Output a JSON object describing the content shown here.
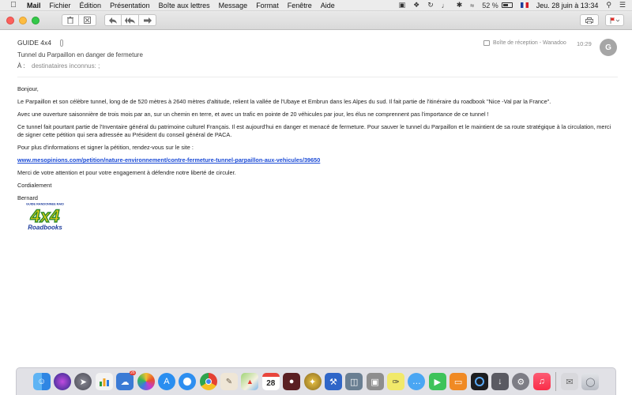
{
  "menubar": {
    "app_name": "Mail",
    "menus": [
      "Fichier",
      "Édition",
      "Présentation",
      "Boîte aux lettres",
      "Message",
      "Format",
      "Fenêtre",
      "Aide"
    ],
    "battery": "52 %",
    "clock": "Jeu. 28 juin à 13:34"
  },
  "message": {
    "subject": "GUIDE 4x4",
    "subtitle": "Tunnel du Parpaillon en danger de fermeture",
    "to_label": "À :",
    "to_value": "destinataires inconnus: ;",
    "mailbox": "Boîte de réception - Wanadoo",
    "time": "10:29",
    "avatar_initial": "G"
  },
  "body": {
    "greeting": "Bonjour,",
    "p1": "Le Parpaillon et son célèbre tunnel, long de de 520 mètres à 2640 mètres d'altitude, relient la vallée de l'Ubaye et Embrun dans les Alpes du sud. Il fait partie de l'itinéraire du roadbook \"Nice -Val par la France\".",
    "p2": "Avec une ouverture saisonnière de trois mois par an, sur un chemin en terre, et avec un trafic en pointe de 20 véhicules par jour, les élus ne comprennent pas l'importance de ce tunnel !",
    "p3": "Ce tunnel fait pourtant partie de l'Inventaire général du patrimoine culturel Français. Il est aujourd'hui en danger et menacé de fermeture. Pour sauver le tunnel du Parpaillon et le maintient de sa route stratégique à la circulation, merci de signer cette pétition qui sera adressée au Président du conseil général de PACA.",
    "p4": "Pour plus d'informations et signer la pétition, rendez-vous sur le site :",
    "link": "www.mesopinions.com/petition/nature-environnement/contre-fermeture-tunnel-parpaillon-aux-vehicules/39650",
    "p5": "Merci de votre attention et pour votre engagement à défendre notre liberté de circuler.",
    "closing": "Cordialement",
    "signature": "Bernard",
    "logo_top": "GUIDE RANDONNEE RAID",
    "logo_main": "4x4",
    "logo_bottom": "Roadbooks"
  },
  "dock": {
    "calendar_day": "28",
    "badge_count": "26",
    "icons": [
      "finder-icon",
      "siri-icon",
      "launchpad-icon",
      "numbers-icon",
      "preview-icon",
      "photos-icon",
      "appstore-icon",
      "safari-icon",
      "chrome-icon",
      "gimp-icon",
      "maps-icon",
      "calendar-icon",
      "photo-booth-icon",
      "compass-icon",
      "xcode-icon",
      "virtualbox-icon",
      "image-capture-icon",
      "script-editor-icon",
      "messages-icon",
      "facetime-icon",
      "books-icon",
      "quicktime-icon",
      "downloads-icon",
      "system-prefs-icon",
      "music-icon",
      "mail-folder-icon",
      "trash-icon"
    ]
  }
}
